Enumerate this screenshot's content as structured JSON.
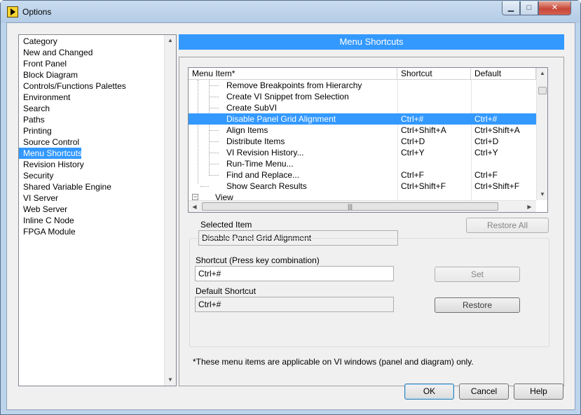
{
  "window": {
    "title": "Options"
  },
  "category_list": {
    "items": [
      "Category",
      "New and Changed",
      "Front Panel",
      "Block Diagram",
      "Controls/Functions Palettes",
      "Environment",
      "Search",
      "Paths",
      "Printing",
      "Source Control",
      "Menu Shortcuts",
      "Revision History",
      "Security",
      "Shared Variable Engine",
      "VI Server",
      "Web Server",
      "Inline C Node",
      "FPGA Module"
    ],
    "selected": "Menu Shortcuts"
  },
  "section_title": "Menu Shortcuts",
  "shortcut_table": {
    "columns": [
      "Menu Item*",
      "Shortcut",
      "Default"
    ],
    "rows": [
      {
        "item": "Remove Breakpoints from Hierarchy",
        "shortcut": "",
        "default": ""
      },
      {
        "item": "Create VI Snippet from Selection",
        "shortcut": "",
        "default": ""
      },
      {
        "item": "Create SubVI",
        "shortcut": "",
        "default": ""
      },
      {
        "item": "Disable Panel Grid Alignment",
        "shortcut": "Ctrl+#",
        "default": "Ctrl+#"
      },
      {
        "item": "Align Items",
        "shortcut": "Ctrl+Shift+A",
        "default": "Ctrl+Shift+A"
      },
      {
        "item": "Distribute Items",
        "shortcut": "Ctrl+D",
        "default": "Ctrl+D"
      },
      {
        "item": "VI Revision History...",
        "shortcut": "Ctrl+Y",
        "default": "Ctrl+Y"
      },
      {
        "item": "Run-Time Menu...",
        "shortcut": "",
        "default": ""
      },
      {
        "item": "Find and Replace...",
        "shortcut": "Ctrl+F",
        "default": "Ctrl+F"
      },
      {
        "item": "Show Search Results",
        "shortcut": "Ctrl+Shift+F",
        "default": "Ctrl+Shift+F"
      },
      {
        "item": "View",
        "shortcut": "",
        "default": ""
      }
    ],
    "selected_row": "Disable Panel Grid Alignment"
  },
  "selected_item": {
    "label": "Selected Item",
    "value": "Disable Panel Grid Alignment"
  },
  "buttons": {
    "restore_all": "Restore All",
    "set": "Set",
    "restore": "Restore",
    "ok": "OK",
    "cancel": "Cancel",
    "help": "Help"
  },
  "shortcut_field": {
    "label": "Shortcut (Press key combination)",
    "value": "Ctrl+#"
  },
  "default_shortcut": {
    "label": "Default Shortcut",
    "value": "Ctrl+#"
  },
  "footnote": "*These menu items are applicable on VI windows (panel and diagram) only."
}
